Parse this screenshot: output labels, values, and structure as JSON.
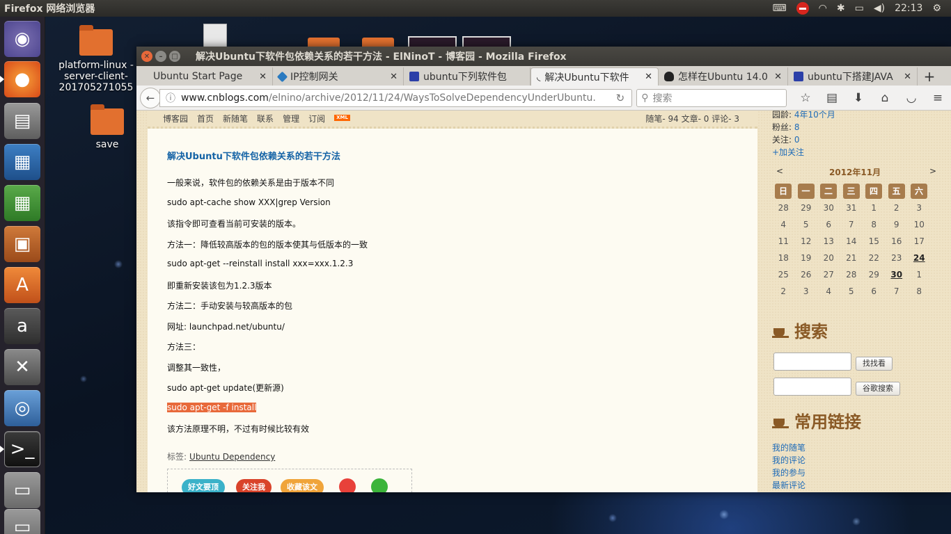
{
  "top_panel": {
    "app_title": "Firefox 网络浏览器",
    "clock": "22:13"
  },
  "desktop": {
    "items": [
      {
        "label": "platform-linux -\nserver-client-\n201705271055"
      },
      {
        "label": "save"
      }
    ]
  },
  "window": {
    "title": "解决Ubuntu下软件包依赖关系的若干方法 - ElNinoT - 博客园 - Mozilla Firefox",
    "tabs": [
      {
        "label": "Ubuntu Start Page",
        "active": false
      },
      {
        "label": "IP控制网关",
        "active": false
      },
      {
        "label": "ubuntu下列软件包",
        "active": false
      },
      {
        "label": "解决Ubuntu下软件",
        "active": true
      },
      {
        "label": "怎样在Ubuntu 14.0",
        "active": false
      },
      {
        "label": "ubuntu下搭建JAVA",
        "active": false
      }
    ],
    "url_host": "www.cnblogs.com",
    "url_path": "/elnino/archive/2012/11/24/WaysToSolveDependencyUnderUbuntu.",
    "search_placeholder": "搜索"
  },
  "blog": {
    "topnav": [
      "博客园",
      "首页",
      "新随笔",
      "联系",
      "管理",
      "订阅"
    ],
    "xml_badge": "XML",
    "stats": "随笔- 94  文章- 0  评论- 3",
    "post_title": "解决Ubuntu下软件包依赖关系的若干方法",
    "paragraphs": [
      "一般来说，软件包的依赖关系是由于版本不同",
      "sudo apt-cache show XXX|grep Version",
      "该指令即可查看当前可安装的版本。",
      "方法一：降低较高版本的包的版本使其与低版本的一致",
      "sudo apt-get --reinstall install xxx=xxx.1.2.3",
      "即重新安装该包为1.2.3版本",
      "方法二：手动安装与较高版本的包",
      "网址: launchpad.net/ubuntu/",
      "方法三：",
      "调整其一致性，",
      "sudo apt-get update(更新源)",
      "sudo apt-get -f install",
      "该方法原理不明，不过有时候比较有效"
    ],
    "tags_label": "标签:",
    "tags_value": "Ubuntu Dependency",
    "share_buttons": [
      "好文要顶",
      "关注我",
      "收藏该文"
    ]
  },
  "sidebar": {
    "age_label": "园龄:",
    "age_value": "4年10个月",
    "fans_label": "粉丝:",
    "fans_value": "8",
    "follow_label": "关注:",
    "follow_value": "0",
    "add_follow": "+加关注",
    "calendar": {
      "prev": "<",
      "next": ">",
      "month": "2012年11月",
      "weekdays": [
        "日",
        "一",
        "二",
        "三",
        "四",
        "五",
        "六"
      ],
      "weeks": [
        [
          "28",
          "29",
          "30",
          "31",
          "1",
          "2",
          "3"
        ],
        [
          "4",
          "5",
          "6",
          "7",
          "8",
          "9",
          "10"
        ],
        [
          "11",
          "12",
          "13",
          "14",
          "15",
          "16",
          "17"
        ],
        [
          "18",
          "19",
          "20",
          "21",
          "22",
          "23",
          "24"
        ],
        [
          "25",
          "26",
          "27",
          "28",
          "29",
          "30",
          "1"
        ],
        [
          "2",
          "3",
          "4",
          "5",
          "6",
          "7",
          "8"
        ]
      ],
      "linked_days": [
        "24",
        "30"
      ]
    },
    "search_title": "搜索",
    "search_btn1": "找找看",
    "search_btn2": "谷歌搜索",
    "links_title": "常用链接",
    "links": [
      "我的随笔",
      "我的评论",
      "我的参与",
      "最新评论"
    ]
  },
  "colors": {
    "accent_orange": "#e8693a",
    "link_blue": "#1463a6",
    "sidebar_brown": "#8a5a26"
  }
}
